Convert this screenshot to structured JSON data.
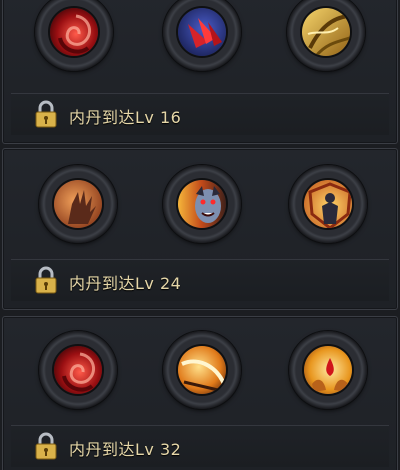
{
  "tiers": [
    {
      "lock_label": "内丹到达Lv 16",
      "skills": [
        {
          "icon": "crimson-swirl-icon"
        },
        {
          "icon": "red-claw-icon"
        },
        {
          "icon": "golden-shell-icon"
        }
      ]
    },
    {
      "lock_label": "内丹到达Lv 24",
      "skills": [
        {
          "icon": "clawed-hand-icon"
        },
        {
          "icon": "vampire-face-icon"
        },
        {
          "icon": "guardian-shield-icon"
        }
      ]
    },
    {
      "lock_label": "内丹到达Lv 32",
      "skills": [
        {
          "icon": "crimson-swirl-icon"
        },
        {
          "icon": "slash-arc-icon"
        },
        {
          "icon": "blood-hands-icon"
        }
      ]
    }
  ]
}
